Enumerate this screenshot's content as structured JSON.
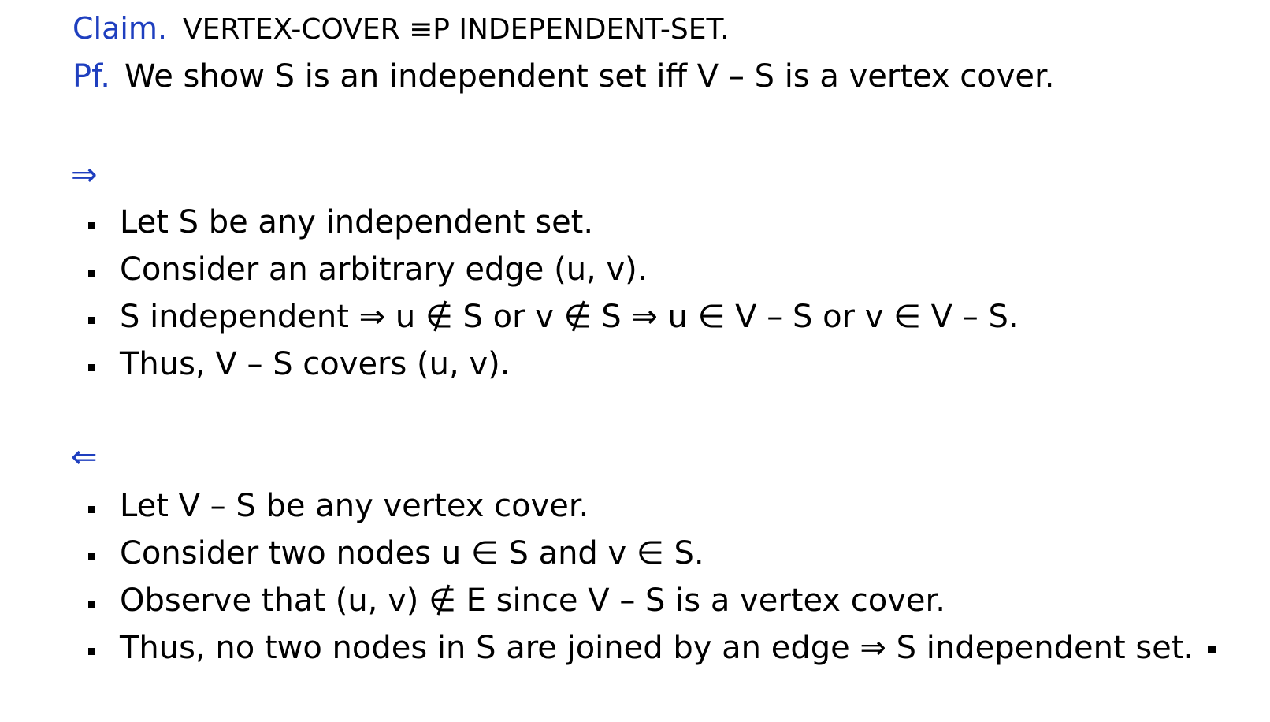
{
  "claim": {
    "label": "Claim.",
    "text": "VERTEX-COVER ≡P INDEPENDENT-SET."
  },
  "proof": {
    "label": "Pf.",
    "text": "We show S is an independent set iff V – S is a vertex cover."
  },
  "forward": {
    "arrow": "⇒",
    "bullets": [
      "Let S be any independent set.",
      "Consider an arbitrary edge (u, v).",
      "S independent ⇒ u ∉ S or v ∉ S  ⇒  u ∈ V – S or v ∈ V – S.",
      "Thus, V – S covers (u, v)."
    ]
  },
  "backward": {
    "arrow": "⇐",
    "bullets": [
      "Let V – S be any vertex cover.",
      "Consider two nodes u ∈ S and v ∈ S.",
      "Observe that (u, v) ∉ E since V – S is a vertex cover.",
      "Thus, no two nodes in S are joined by an edge ⇒ S independent set."
    ]
  },
  "colors": {
    "accent": "#1f3fbf",
    "text": "#000000",
    "background": "#ffffff"
  }
}
